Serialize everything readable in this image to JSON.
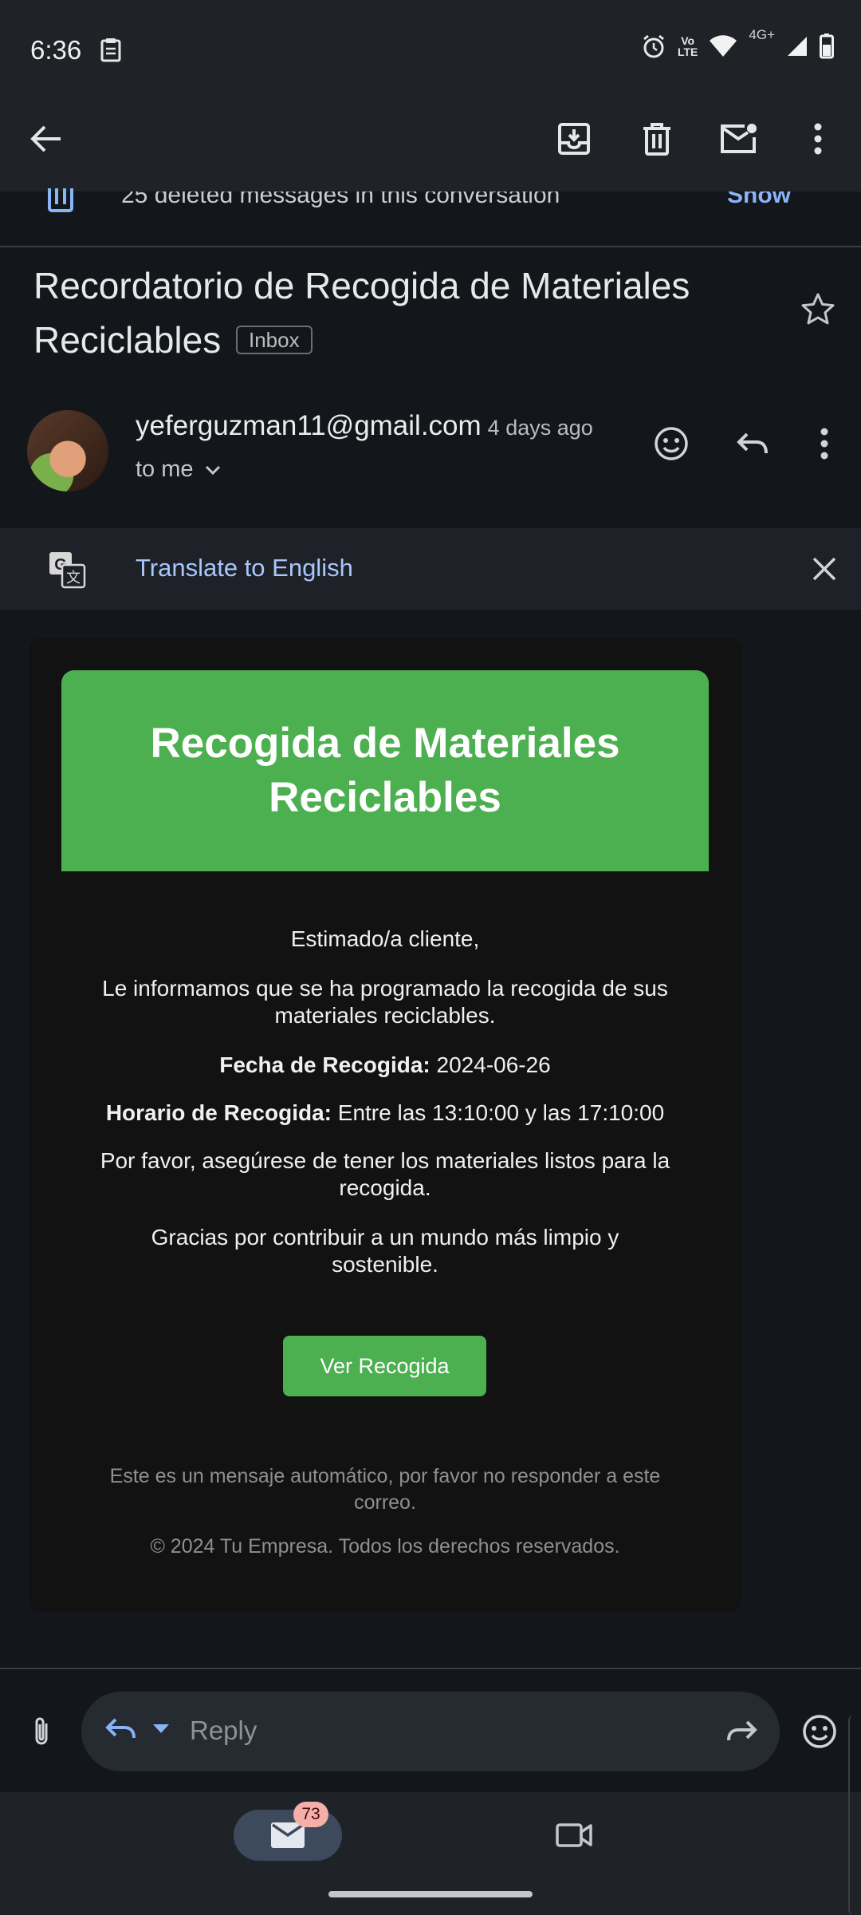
{
  "status_bar": {
    "time": "6:36",
    "network": "4G+",
    "volte_top": "Vo",
    "volte_bottom": "LTE"
  },
  "app_bar": {
    "icons": [
      "back-arrow-icon",
      "archive-icon",
      "trash-icon",
      "mark-unread-icon",
      "more-vert-icon"
    ]
  },
  "conversation": {
    "deleted_notice": "25 deleted messages in this conversation",
    "show_label": "Show"
  },
  "subject": {
    "title": "Recordatorio de Recogida de Materiales Reciclables",
    "badge": "Inbox"
  },
  "sender": {
    "email": "yeferguzman11@gmail.com",
    "time": "4 days ago",
    "recipient": "to me"
  },
  "translate": {
    "label": "Translate to English"
  },
  "email": {
    "header_title": "Recogida de Materiales Reciclables",
    "greeting": "Estimado/a cliente,",
    "intro": "Le informamos que se ha programado la recogida de sus materiales reciclables.",
    "date_label": "Fecha de Recogida:",
    "date_value": "2024-06-26",
    "time_label": "Horario de Recogida:",
    "time_value": "Entre las 13:10:00 y las 17:10:00",
    "reminder": "Por favor, asegúrese de tener los materiales listos para la recogida.",
    "thanks": "Gracias por contribuir a un mundo más limpio y sostenible.",
    "button_label": "Ver Recogida",
    "footer_auto": "Este es un mensaje automático, por favor no responder a este correo.",
    "footer_copyright": "© 2024 Tu Empresa. Todos los derechos reservados.",
    "accent_color": "#4caf50"
  },
  "reply_bar": {
    "placeholder": "Reply"
  },
  "bottom_nav": {
    "mail_badge": "73"
  }
}
